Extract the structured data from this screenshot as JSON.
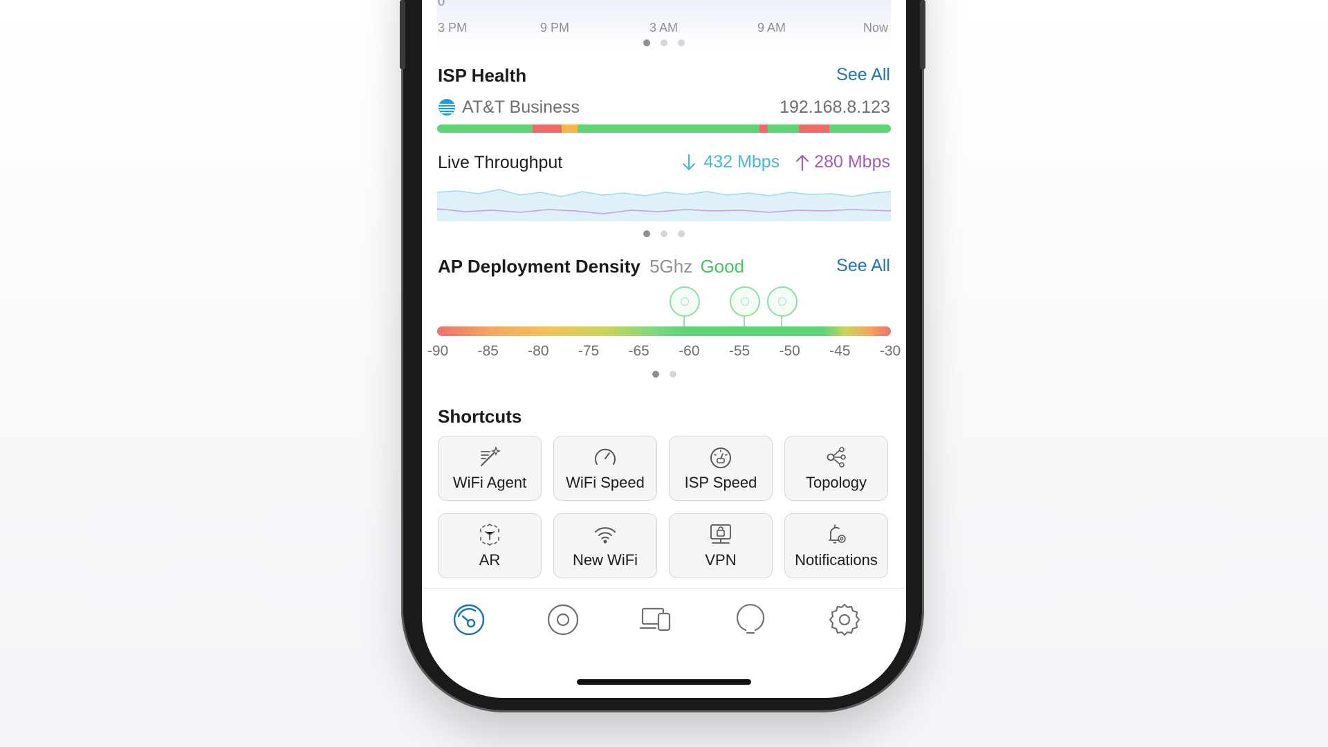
{
  "top_chart": {
    "y_zero_label": "0",
    "x_ticks": [
      "3 PM",
      "9 PM",
      "3 AM",
      "9 AM",
      "Now"
    ],
    "page_dots": {
      "count": 3,
      "active": 0
    }
  },
  "isp_health": {
    "title": "ISP Health",
    "see_all": "See All",
    "provider": "AT&T Business",
    "ip": "192.168.8.123",
    "health_segments": [
      {
        "status": "good",
        "fraction": 0.21
      },
      {
        "status": "bad",
        "fraction": 0.065
      },
      {
        "status": "warn",
        "fraction": 0.035
      },
      {
        "status": "good",
        "fraction": 0.4
      },
      {
        "status": "bad",
        "fraction": 0.018
      },
      {
        "status": "good",
        "fraction": 0.07
      },
      {
        "status": "bad",
        "fraction": 0.067
      },
      {
        "status": "good",
        "fraction": 0.135
      }
    ],
    "colors": {
      "good": "#5dd476",
      "bad": "#f06a6a",
      "warn": "#f5b547"
    }
  },
  "live_throughput": {
    "title": "Live Throughput",
    "download": "432 Mbps",
    "upload": "280 Mbps",
    "download_color": "#45b7d9",
    "upload_color": "#a55bc4",
    "page_dots": {
      "count": 3,
      "active": 0
    }
  },
  "ap_density": {
    "title": "AP Deployment Density",
    "band": "5Ghz",
    "status": "Good",
    "status_color": "#45c463",
    "see_all": "See All",
    "scale_labels": [
      "-90",
      "-85",
      "-80",
      "-75",
      "-65",
      "-60",
      "-55",
      "-50",
      "-45",
      "-30"
    ],
    "ap_values_dbm": [
      -60.5,
      -54.5,
      -50.8
    ],
    "page_dots": {
      "count": 2,
      "active": 0
    }
  },
  "shortcuts": {
    "title": "Shortcuts",
    "items": [
      {
        "label": "WiFi Agent",
        "icon": "magic-wand-icon"
      },
      {
        "label": "WiFi Speed",
        "icon": "speedometer-icon"
      },
      {
        "label": "ISP Speed",
        "icon": "speed-gauge-icon"
      },
      {
        "label": "Topology",
        "icon": "topology-icon"
      },
      {
        "label": "AR",
        "icon": "ar-cube-icon"
      },
      {
        "label": "New WiFi",
        "icon": "wifi-icon"
      },
      {
        "label": "VPN",
        "icon": "vpn-lock-icon"
      },
      {
        "label": "Notifications",
        "icon": "bell-gear-icon"
      }
    ]
  },
  "tabbar": {
    "items": [
      "dashboard-icon",
      "router-icon",
      "devices-icon",
      "insights-icon",
      "settings-icon"
    ],
    "active": 0,
    "active_color": "#1e73be"
  }
}
